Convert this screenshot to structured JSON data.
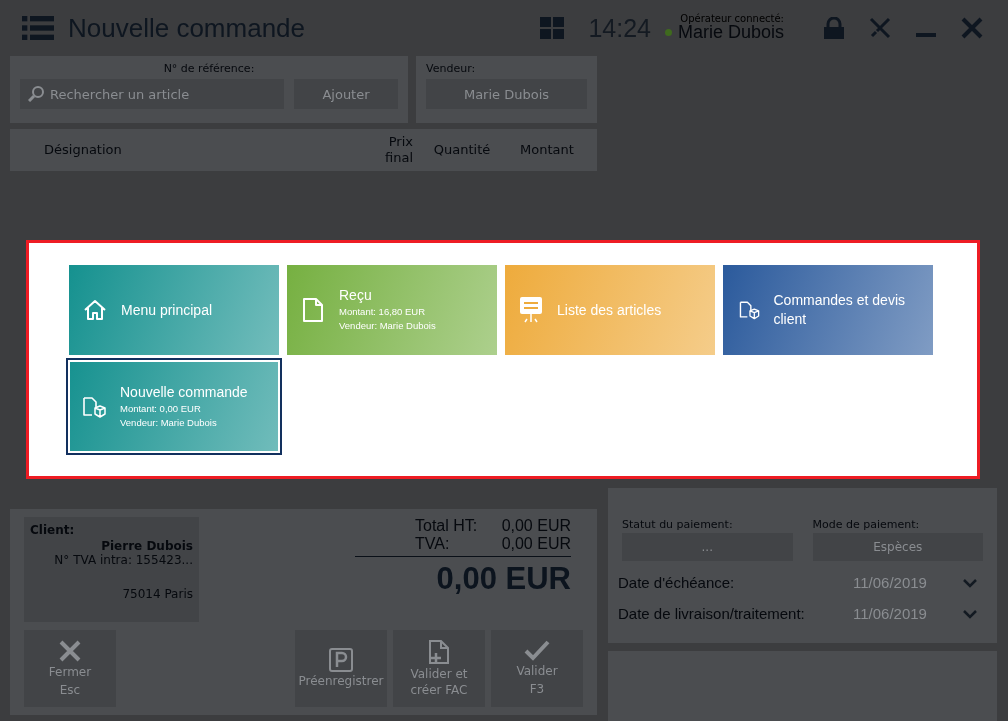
{
  "header": {
    "title": "Nouvelle commande",
    "clock": "14:24",
    "operator_label": "Opérateur connecté:",
    "operator_name": "Marie Dubois",
    "online": true
  },
  "reference": {
    "label": "N° de référence:",
    "placeholder": "Rechercher un article",
    "add_button": "Ajouter"
  },
  "seller": {
    "label": "Vendeur:",
    "value": "Marie Dubois"
  },
  "table": {
    "columns": [
      "Désignation",
      "Prix final",
      "Quantité",
      "Montant"
    ]
  },
  "client": {
    "label": "Client:",
    "name": "Pierre Dubois",
    "vat": "N° TVA intra: 155423...",
    "city": "75014 Paris"
  },
  "totals": {
    "rows": [
      {
        "label": "Total HT:",
        "value": "0,00 EUR"
      },
      {
        "label": "TVA:",
        "value": "0,00 EUR"
      }
    ],
    "grand_total": "0,00 EUR"
  },
  "actions": [
    {
      "kind": "close",
      "label": "Fermer",
      "shortcut": "Esc"
    },
    {
      "kind": "park",
      "label": "Préenregistrer"
    },
    {
      "kind": "invoice",
      "label": "Valider et créer FAC"
    },
    {
      "kind": "validate",
      "label": "Valider",
      "shortcut": "F3"
    }
  ],
  "payment": {
    "status_label": "Statut du paiement:",
    "status_value": "...",
    "mode_label": "Mode de paiement:",
    "mode_value": "Espèces"
  },
  "dates": [
    {
      "label": "Date d'échéance:",
      "value": "11/06/2019"
    },
    {
      "label": "Date de livraison/traitement:",
      "value": "11/06/2019"
    }
  ],
  "tiles": [
    {
      "kind": "home",
      "title": "Menu principal",
      "color": "#15918f",
      "selected": false
    },
    {
      "kind": "receipt",
      "title": "Reçu",
      "lines": [
        "Montant: 16,80 EUR",
        "Vendeur: Marie Dubois"
      ],
      "color": "#76b041",
      "selected": false
    },
    {
      "kind": "sale",
      "title": "Liste des articles",
      "color": "#eeab3c",
      "selected": false
    },
    {
      "kind": "orders",
      "title": "Commandes et devis client",
      "color": "#2b5a9c",
      "selected": false
    },
    {
      "kind": "orders",
      "title": "Nouvelle commande",
      "lines": [
        "Montant: 0,00 EUR",
        "Vendeur: Marie Dubois"
      ],
      "color": "#15918f",
      "selected": true
    }
  ]
}
